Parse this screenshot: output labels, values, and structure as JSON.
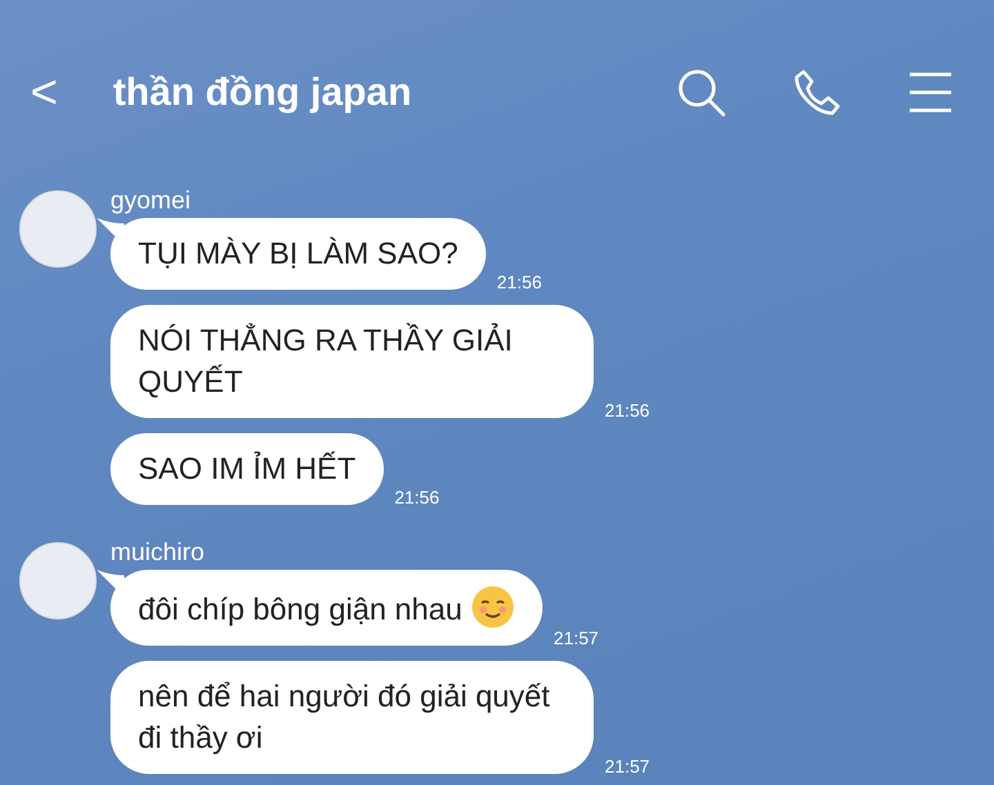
{
  "header": {
    "back": "<",
    "title": "thần đồng japan"
  },
  "groups": [
    {
      "sender": "gyomei",
      "messages": [
        {
          "text": "TỤI MÀY BỊ LÀM SAO?",
          "time": "21:56",
          "emoji": false
        },
        {
          "text": "NÓI THẲNG RA THẦY GIẢI QUYẾT",
          "time": "21:56",
          "emoji": false
        },
        {
          "text": "SAO IM ỈM HẾT",
          "time": "21:56",
          "emoji": false
        }
      ]
    },
    {
      "sender": "muichiro",
      "messages": [
        {
          "text": "đôi chíp bông giận nhau",
          "time": "21:57",
          "emoji": true
        },
        {
          "text": "nên để hai người đó giải quyết đi thầy ơi",
          "time": "21:57",
          "emoji": false
        }
      ]
    }
  ]
}
